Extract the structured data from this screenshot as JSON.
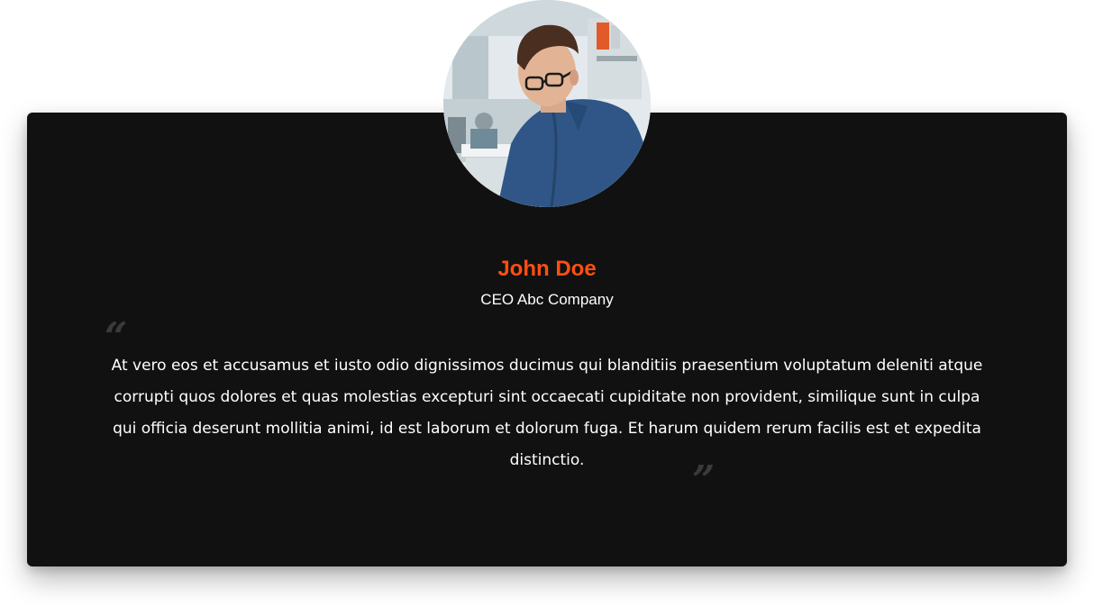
{
  "testimonial": {
    "name": "John Doe",
    "role": "CEO Abc Company",
    "quote": "At vero eos et accusamus et iusto odio dignissimos ducimus qui blanditiis praesentium voluptatum deleniti atque corrupti quos dolores et quas molestias excepturi sint occaecati cupiditate non provident, similique sunt in culpa qui officia deserunt mollitia animi, id est laborum et dolorum fuga. Et harum quidem rerum facilis est et expedita distinctio.",
    "open_quote_glyph": "“",
    "close_quote_glyph": "”",
    "avatar_icon": "person-photo"
  },
  "colors": {
    "card_background": "#111111",
    "name_accent": "#ff4f12",
    "text": "#ffffff",
    "quote_mark": "#3a3a3a"
  }
}
